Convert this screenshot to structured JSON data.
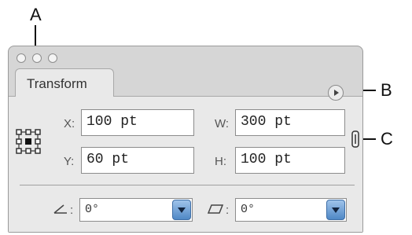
{
  "callouts": {
    "a": "A",
    "b": "B",
    "c": "C"
  },
  "panel": {
    "tab_label": "Transform",
    "menu_icon": "flyout-menu-icon",
    "reference_point_icon": "reference-point-locator-icon",
    "link_icon": "constrain-proportions-icon"
  },
  "fields": {
    "x": {
      "label": "X:",
      "value": "100 pt"
    },
    "y": {
      "label": "Y:",
      "value": "60 pt"
    },
    "w": {
      "label": "W:",
      "value": "300 pt"
    },
    "h": {
      "label": "H:",
      "value": "100 pt"
    }
  },
  "rotate": {
    "label": ":",
    "value": "0°",
    "icon": "rotate-angle-icon"
  },
  "shear": {
    "label": ":",
    "value": "0°",
    "icon": "shear-angle-icon"
  },
  "colors": {
    "panel_bg": "#e9e9e9",
    "dropdown_blue": "#4f88c6"
  }
}
